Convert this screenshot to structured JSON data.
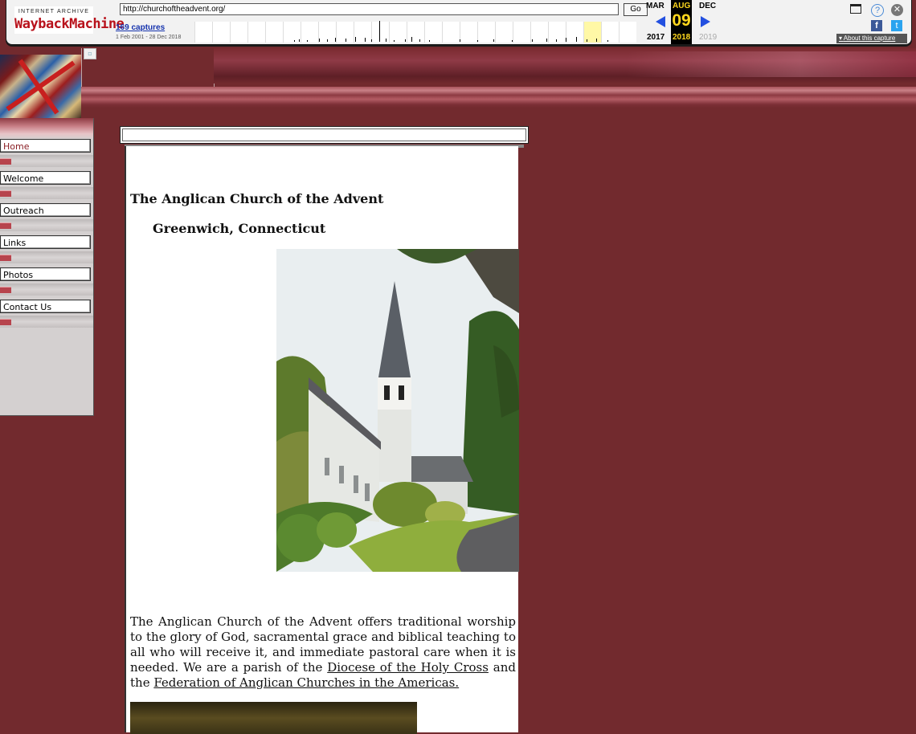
{
  "wayback": {
    "logo_top": "INTERNET ARCHIVE",
    "logo_bottom": "WaybackMachine",
    "url": "http://churchoftheadvent.org/",
    "go_label": "Go",
    "captures_label": "169 captures",
    "date_range": "1 Feb 2001 - 28 Dec 2018",
    "months": {
      "prev": "MAR",
      "current": "AUG",
      "next": "DEC"
    },
    "day": "09",
    "years": {
      "prev": "2017",
      "current": "2018",
      "next": "2019"
    },
    "about_label": "About this capture",
    "icons": [
      "window-icon",
      "help-icon",
      "close-icon",
      "facebook-icon",
      "twitter-icon"
    ]
  },
  "sidebar": {
    "items": [
      {
        "label": "Home",
        "active": true
      },
      {
        "label": "Welcome",
        "active": false
      },
      {
        "label": "Outreach",
        "active": false
      },
      {
        "label": "Links",
        "active": false
      },
      {
        "label": "Photos",
        "active": false
      },
      {
        "label": "Contact Us",
        "active": false
      }
    ]
  },
  "content": {
    "title": "The Anglican Church of the Advent",
    "location": "Greenwich, Connecticut",
    "intro": {
      "text": "The Anglican Church of the Advent offers traditional worship to the glory of God, sacramental grace and biblical teaching to all who will receive it, and immediate pastoral care when it is needed. We are a parish of the ",
      "link1": "Diocese of the Holy Cross",
      "mid": " and the ",
      "link2": " Federation of Anglican Churches in the Americas."
    }
  },
  "colors": {
    "page_bg": "#722a2e",
    "wayback_accent": "#ffd81e",
    "captures_link": "#1533ad"
  }
}
